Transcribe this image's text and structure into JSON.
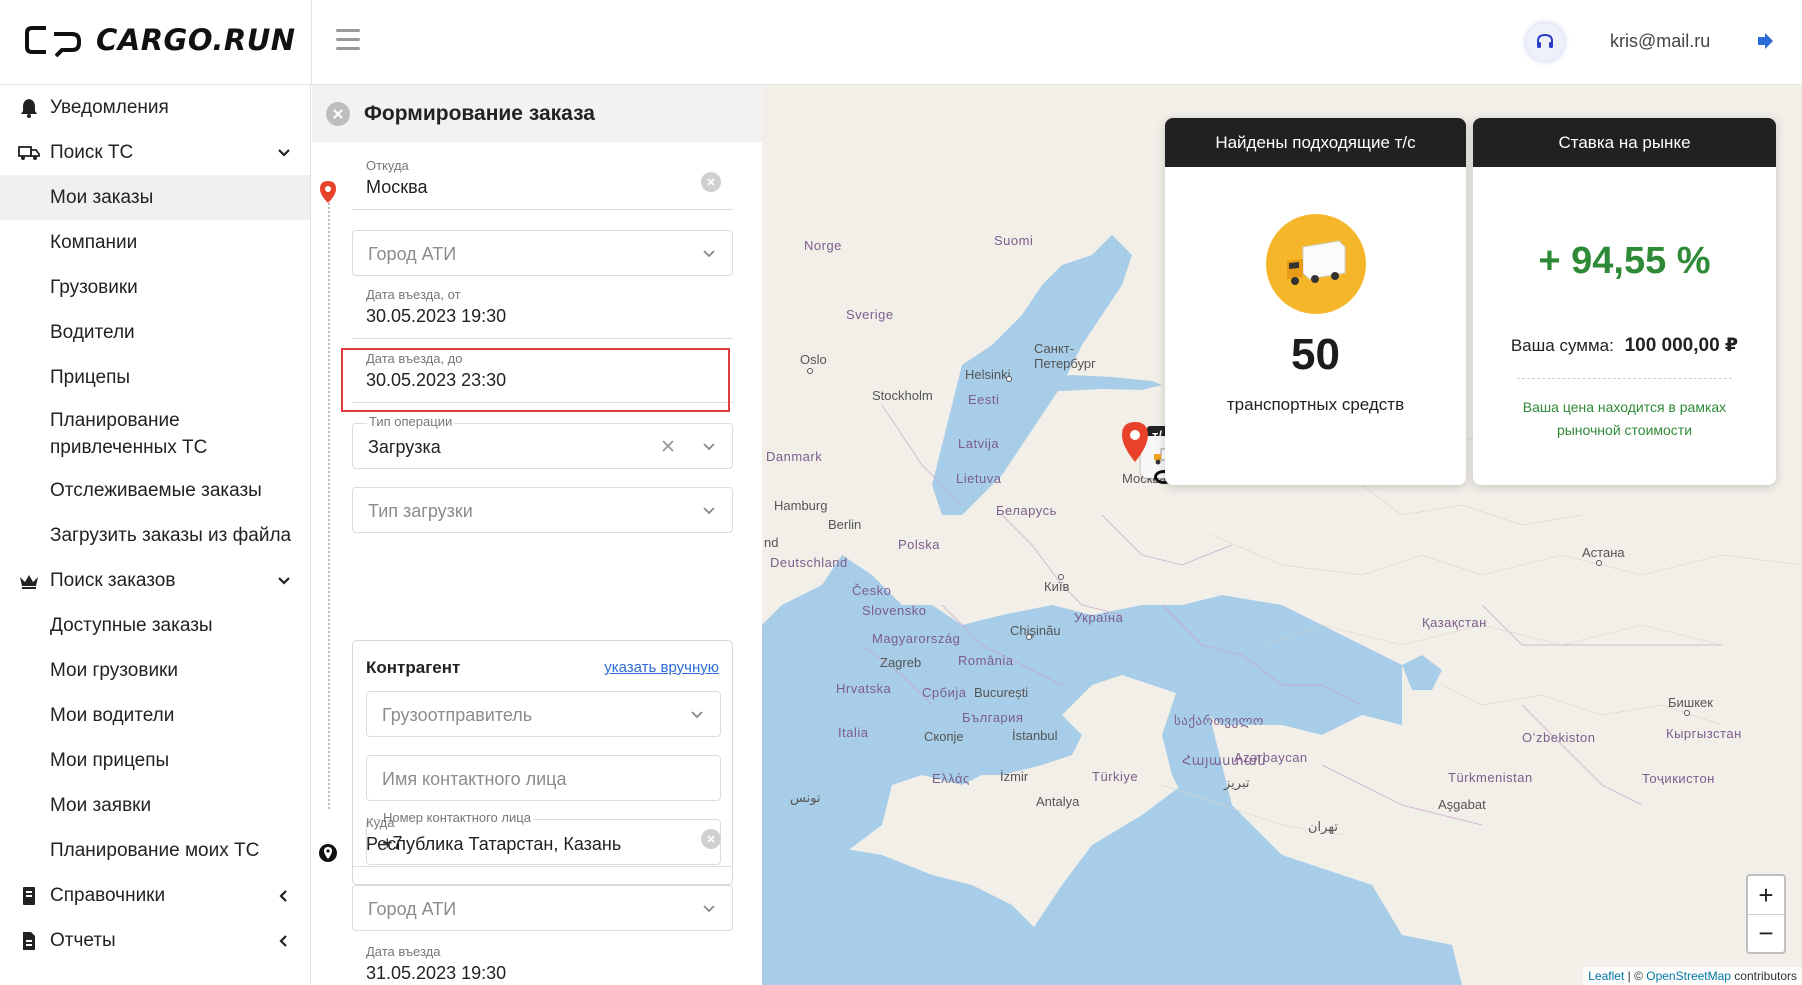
{
  "header": {
    "logo_text": "CARGO.RUN",
    "user_email": "kris@mail.ru"
  },
  "sidebar": {
    "items": [
      {
        "label": "Уведомления",
        "icon": "bell-icon",
        "type": "section"
      },
      {
        "label": "Поиск ТС",
        "icon": "truck-search-icon",
        "type": "section",
        "chevron": "down"
      },
      {
        "label": "Мои заказы",
        "active": true
      },
      {
        "label": "Компании"
      },
      {
        "label": "Грузовики"
      },
      {
        "label": "Водители"
      },
      {
        "label": "Прицепы"
      },
      {
        "label": "Планирование привлеченных ТС"
      },
      {
        "label": "Отслеживаемые заказы"
      },
      {
        "label": "Загрузить заказы из файла"
      },
      {
        "label": "Поиск заказов",
        "icon": "crown-icon",
        "type": "section",
        "chevron": "down"
      },
      {
        "label": "Доступные заказы"
      },
      {
        "label": "Мои грузовики"
      },
      {
        "label": "Мои водители"
      },
      {
        "label": "Мои прицепы"
      },
      {
        "label": "Мои заявки"
      },
      {
        "label": "Планирование моих ТС"
      },
      {
        "label": "Справочники",
        "icon": "book-icon",
        "type": "section",
        "chevron": "left"
      },
      {
        "label": "Отчеты",
        "icon": "report-icon",
        "type": "section",
        "chevron": "left"
      }
    ]
  },
  "order": {
    "title": "Формирование заказа",
    "from": {
      "label": "Откуда",
      "value": "Москва"
    },
    "ati_city_1": {
      "placeholder": "Город АТИ"
    },
    "date_from": {
      "label": "Дата въезда, от",
      "value": "30.05.2023 19:30"
    },
    "date_to": {
      "label": "Дата въезда, до",
      "value": "30.05.2023 23:30"
    },
    "operation": {
      "label": "Тип операции",
      "value": "Загрузка"
    },
    "load_type": {
      "placeholder": "Тип загрузки"
    },
    "counterparty": {
      "title": "Контрагент",
      "manual_link": "указать вручную",
      "shipper_placeholder": "Грузоотправитель",
      "contact_name_placeholder": "Имя контактного лица",
      "contact_phone_label": "Номер контактного лица",
      "contact_phone_value": "+7"
    },
    "to": {
      "label": "Куда",
      "value": "Республика Татарстан, Казань"
    },
    "ati_city_2": {
      "placeholder": "Город АТИ"
    },
    "arrival_date": {
      "label": "Дата въезда",
      "value": "31.05.2023 19:30"
    }
  },
  "map": {
    "labels": {
      "norge": "Norge",
      "suomi": "Suomi",
      "sverige": "Sverige",
      "oslo": "Oslo",
      "helsinki": "Helsinki",
      "stockholm": "Stockholm",
      "eesti": "Eesti",
      "spb": "Санкт-\nПетербург",
      "latvija": "Latvija",
      "danmark": "Danmark",
      "lietuva": "Lietuva",
      "hamburg": "Hamburg",
      "berlin": "Berlin",
      "belarus": "Беларусь",
      "nd": "nd",
      "polska": "Polska",
      "deutschland": "Deutschland",
      "cesko": "Česko",
      "kyiv": "Київ",
      "slovensko": "Slovensko",
      "ukraina": "Україна",
      "chisinau": "Chişinău",
      "magyar": "Magyarország",
      "zagreb": "Zagreb",
      "romania": "România",
      "hrvatska": "Hrvatska",
      "srbija": "Србија",
      "bucuresti": "București",
      "bulgaria": "България",
      "italia": "Italia",
      "skopje": "Скопје",
      "istanbul": "İstanbul",
      "sakartvelo": "საქართველო",
      "hayastan": "Հայաստան",
      "azerbaycan": "Azərbaycan",
      "ellas": "Ελλάς",
      "izmir": "İzmir",
      "turkiye": "Türkiye",
      "antalya": "Antalya",
      "tabriz": "تبریز",
      "tunis": "تونس",
      "kazakhstan": "Қазақстан",
      "astana": "Астана",
      "uzbekiston": "Oʻzbekiston",
      "turkmenistan": "Türkmenistan",
      "ashgabat": "Aşgabat",
      "bishkek": "Бишкек",
      "kyrgyzstan": "Кыргызстан",
      "tojikiston": "Тоҷикистон",
      "tehran": "تهران",
      "moskva": "Москва",
      "vehicles_tag": "т/с"
    },
    "vehicles_card": {
      "title": "Найдены подходящие т/с",
      "count": "50",
      "subtitle": "транспортных средств"
    },
    "rate_card": {
      "title": "Ставка на рынке",
      "rate": "+ 94,55 %",
      "sum_label": "Ваша сумма:",
      "sum_value": "100 000,00 ₽",
      "note": "Ваша цена находится в рамках рыночной стоимости"
    },
    "zoom_in": "+",
    "zoom_out": "−",
    "attribution": {
      "leaflet": "Leaflet",
      "sep": " | © ",
      "osm": "OpenStreetMap",
      "tail": " contributors"
    }
  },
  "colors": {
    "accent_red": "#e23c3c",
    "link_blue": "#2d6bd6",
    "rate_green": "#2e8a37",
    "truck_yellow": "#f6b62a",
    "card_head": "#212121"
  }
}
